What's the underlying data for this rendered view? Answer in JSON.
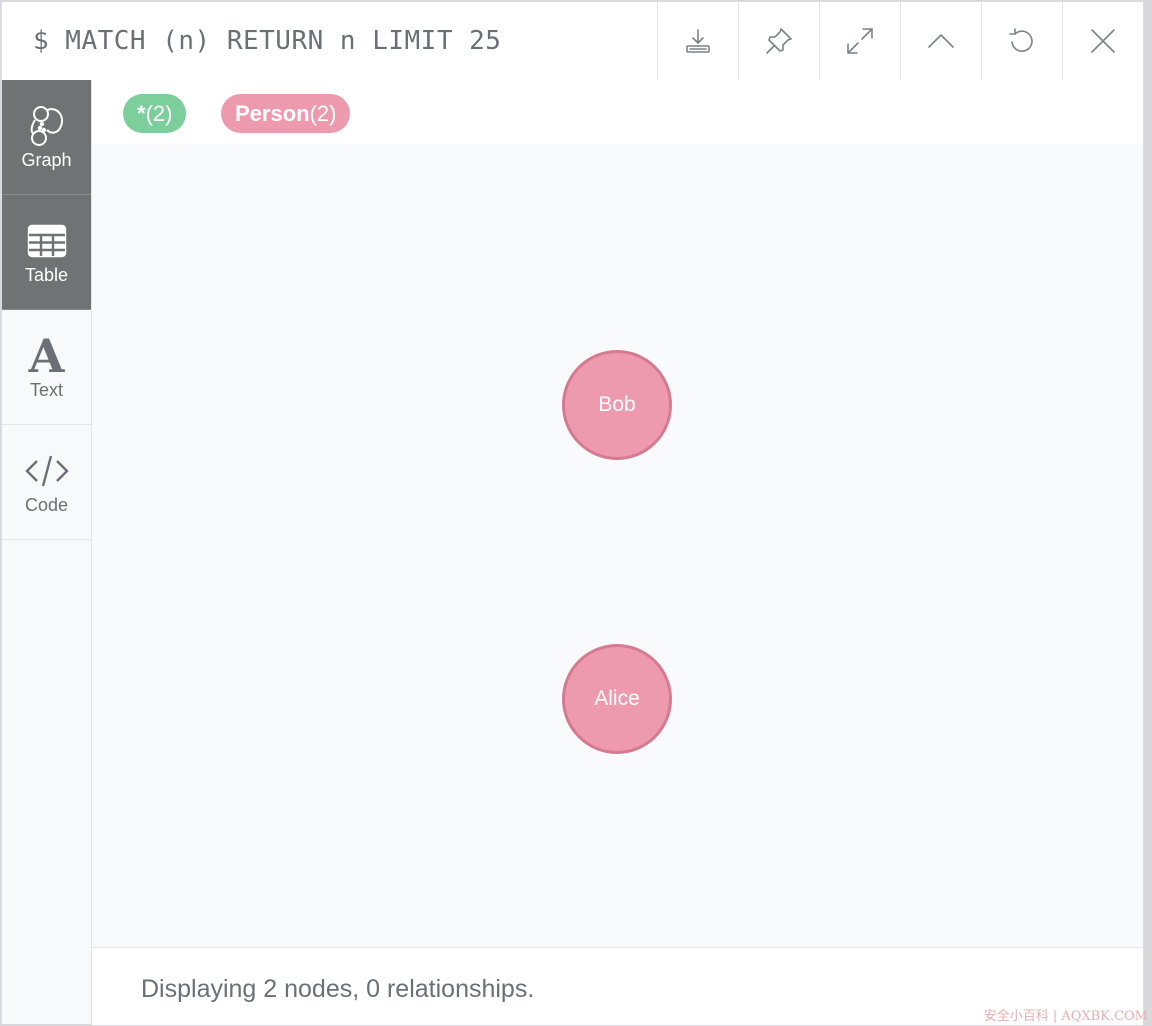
{
  "header": {
    "query": "$ MATCH (n) RETURN n LIMIT 25",
    "toolbar": [
      {
        "icon": "download-icon"
      },
      {
        "icon": "pin-icon"
      },
      {
        "icon": "expand-icon"
      },
      {
        "icon": "collapse-up-icon"
      },
      {
        "icon": "rerun-icon"
      },
      {
        "icon": "close-icon"
      }
    ]
  },
  "sidebar": {
    "tabs": [
      {
        "label": "Graph",
        "icon": "graph-icon",
        "active": true
      },
      {
        "label": "Table",
        "icon": "table-icon",
        "active": true
      },
      {
        "label": "Text",
        "icon": "text-icon",
        "active": false
      },
      {
        "label": "Code",
        "icon": "code-icon",
        "active": false
      }
    ]
  },
  "legend": {
    "all": {
      "label": "*",
      "count": "(2)",
      "color": "#7ccf9b"
    },
    "person": {
      "label": "Person",
      "count": "(2)",
      "color": "#ee9aae"
    }
  },
  "graph": {
    "nodes": [
      {
        "caption": "Bob",
        "label": "Person"
      },
      {
        "caption": "Alice",
        "label": "Person"
      }
    ],
    "node_color": "#ee9aae",
    "node_border": "#d57a91"
  },
  "footer": {
    "status": "Displaying 2 nodes, 0 relationships."
  },
  "watermark": "安全小百科 | AQXBK.COM"
}
